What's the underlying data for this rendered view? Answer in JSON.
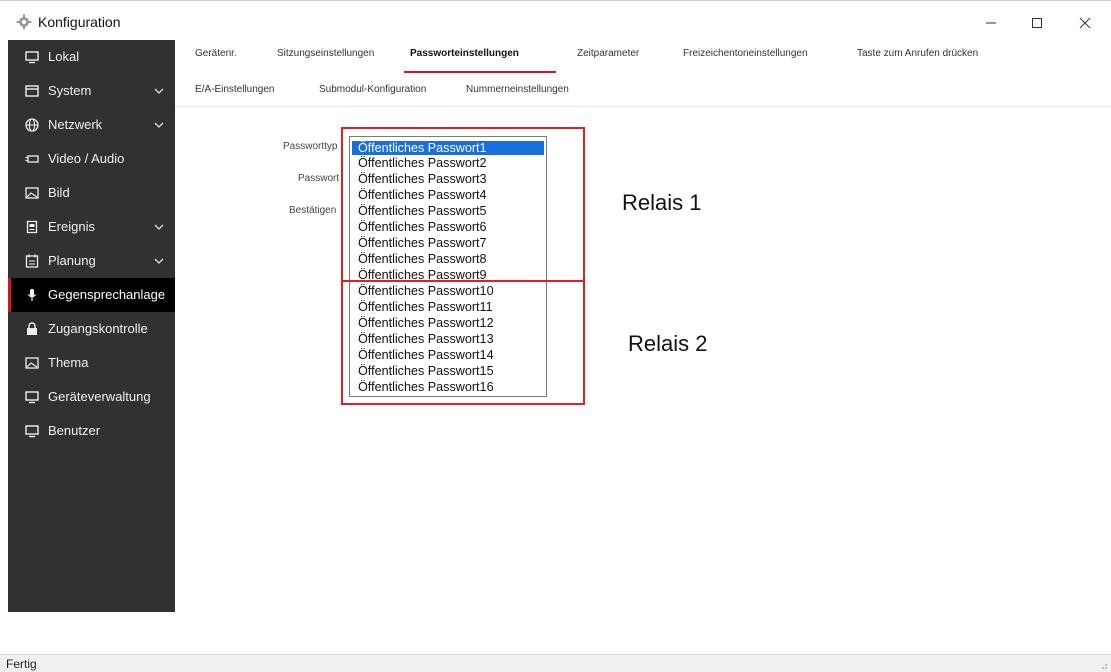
{
  "window": {
    "title": "Konfiguration",
    "icon": "gear-icon"
  },
  "sidebar": {
    "items": [
      {
        "label": "Lokal",
        "icon": "monitor-icon",
        "expandable": false,
        "active": false
      },
      {
        "label": "System",
        "icon": "window-icon",
        "expandable": true,
        "active": false
      },
      {
        "label": "Netzwerk",
        "icon": "globe-icon",
        "expandable": true,
        "active": false
      },
      {
        "label": "Video / Audio",
        "icon": "video-icon",
        "expandable": false,
        "active": false
      },
      {
        "label": "Bild",
        "icon": "image-icon",
        "expandable": false,
        "active": false
      },
      {
        "label": "Ereignis",
        "icon": "event-icon",
        "expandable": true,
        "active": false
      },
      {
        "label": "Planung",
        "icon": "calendar-icon",
        "expandable": true,
        "active": false
      },
      {
        "label": "Gegensprechanlage",
        "icon": "microphone-icon",
        "expandable": false,
        "active": true
      },
      {
        "label": "Zugangskontrolle",
        "icon": "lock-icon",
        "expandable": false,
        "active": false
      },
      {
        "label": "Thema",
        "icon": "image-icon",
        "expandable": false,
        "active": false
      },
      {
        "label": "Geräteverwaltung",
        "icon": "monitor-icon",
        "expandable": false,
        "active": false
      },
      {
        "label": "Benutzer",
        "icon": "monitor-icon",
        "expandable": false,
        "active": false
      }
    ]
  },
  "tabs": {
    "row1": [
      "Gerätenr.",
      "Sitzungseinstellungen",
      "Passworteinstellungen",
      "Zeitparameter",
      "Freizeichentoneinstellungen",
      "Taste zum Anrufen drücken"
    ],
    "row2": [
      "E/A-Einstellungen",
      "Submodul-Konfiguration",
      "Nummerneinstellungen"
    ],
    "active": "Passworteinstellungen"
  },
  "form": {
    "password_type_label": "Passworttyp",
    "password_label": "Passwort",
    "confirm_label": "Bestätigen"
  },
  "dropdown": {
    "selected": "Öffentliches Passwort1",
    "options": [
      "Öffentliches Passwort1",
      "Öffentliches Passwort2",
      "Öffentliches Passwort3",
      "Öffentliches Passwort4",
      "Öffentliches Passwort5",
      "Öffentliches Passwort6",
      "Öffentliches Passwort7",
      "Öffentliches Passwort8",
      "Öffentliches Passwort9",
      "Öffentliches Passwort10",
      "Öffentliches Passwort11",
      "Öffentliches Passwort12",
      "Öffentliches Passwort13",
      "Öffentliches Passwort14",
      "Öffentliches Passwort15",
      "Öffentliches Passwort16"
    ]
  },
  "annotations": {
    "relais1": "Relais 1",
    "relais2": "Relais 2",
    "color": "#e02020"
  },
  "statusbar": {
    "text": "Fertig"
  },
  "colors": {
    "sidebar_bg": "#2f3133",
    "sidebar_active_bg": "#000000",
    "accent": "#d5141c",
    "selection": "#1a6fe0"
  }
}
